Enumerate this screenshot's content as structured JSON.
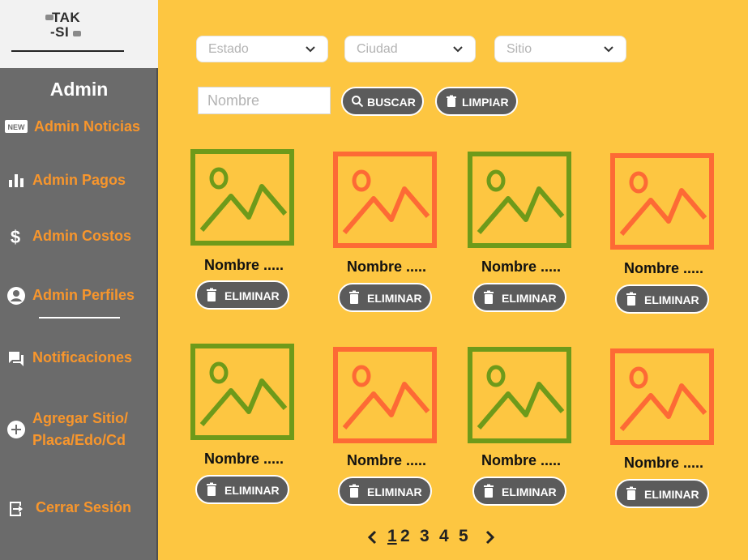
{
  "logo": {
    "line1": "TAK",
    "line2": "-SI"
  },
  "sidebar": {
    "title": "Admin",
    "items": [
      {
        "label": "Admin Noticias",
        "icon": "new-badge-icon"
      },
      {
        "label": "Admin Pagos",
        "icon": "bar-chart-icon"
      },
      {
        "label": "Admin Costos",
        "icon": "dollar-icon"
      },
      {
        "label": "Admin Perfiles",
        "icon": "account-circle-icon"
      },
      {
        "label": "Notificaciones",
        "icon": "chat-bubble-icon"
      },
      {
        "label": "Agregar Sitio/",
        "label2": "Placa/Edo/Cd",
        "icon": "add-circle-icon"
      },
      {
        "label": "Cerrar Sesión",
        "icon": "logout-icon"
      }
    ]
  },
  "filters": {
    "estado": "Estado",
    "ciudad": "Ciudad",
    "sitio": "Sitio",
    "name_placeholder": "Nombre",
    "search_label": "BUSCAR",
    "clear_label": "LIMPIAR"
  },
  "cards": [
    {
      "name": "Nombre .....",
      "delete_label": "ELIMINAR",
      "color": "#6e9a1a"
    },
    {
      "name": "Nombre .....",
      "delete_label": "ELIMINAR",
      "color": "#fd6a35"
    },
    {
      "name": "Nombre .....",
      "delete_label": "ELIMINAR",
      "color": "#6e9a1a"
    },
    {
      "name": "Nombre .....",
      "delete_label": "ELIMINAR",
      "color": "#fd6a35"
    },
    {
      "name": "Nombre .....",
      "delete_label": "ELIMINAR",
      "color": "#6e9a1a"
    },
    {
      "name": "Nombre .....",
      "delete_label": "ELIMINAR",
      "color": "#fd6a35"
    },
    {
      "name": "Nombre .....",
      "delete_label": "ELIMINAR",
      "color": "#6e9a1a"
    },
    {
      "name": "Nombre .....",
      "delete_label": "ELIMINAR",
      "color": "#fd6a35"
    }
  ],
  "pagination": {
    "pages": [
      "1",
      "2",
      "3",
      "4",
      "5"
    ],
    "current": "1"
  },
  "colors": {
    "background": "#fdc641",
    "sidebar": "#6b6b6b",
    "accent": "#f8962c",
    "button": "#5b5b5b"
  }
}
